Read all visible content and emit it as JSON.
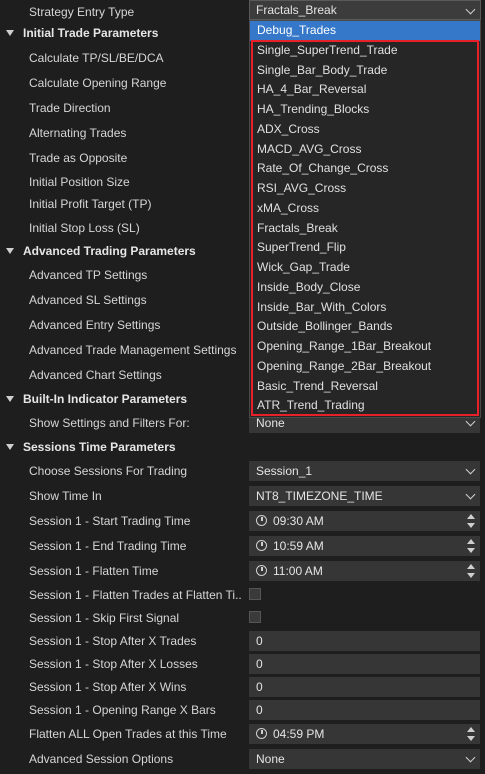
{
  "strategy_entry": {
    "label": "Strategy Entry Type",
    "value": "Fractals_Break"
  },
  "initial_trade": {
    "title": "Initial Trade Parameters",
    "items": [
      "Calculate TP/SL/BE/DCA",
      "Calculate Opening Range",
      "Trade Direction",
      "Alternating Trades",
      "Trade as Opposite",
      "Initial Position Size",
      "Initial Profit Target (TP)",
      "Initial Stop Loss (SL)"
    ]
  },
  "advanced_trading": {
    "title": "Advanced Trading Parameters",
    "items": [
      "Advanced TP Settings",
      "Advanced SL Settings",
      "Advanced Entry Settings",
      "Advanced Trade Management Settings",
      "Advanced Chart Settings"
    ]
  },
  "built_in": {
    "title": "Built-In Indicator Parameters",
    "show_settings_label": "Show Settings and Filters For:",
    "show_settings_value": "None"
  },
  "sessions": {
    "title": "Sessions Time Parameters",
    "choose_label": "Choose Sessions For Trading",
    "choose_value": "Session_1",
    "show_time_label": "Show Time In",
    "show_time_value": "NT8_TIMEZONE_TIME",
    "start_label": "Session 1 - Start Trading Time",
    "start_value": "09:30 AM",
    "end_label": "Session 1 - End Trading Time",
    "end_value": "10:59 AM",
    "flatten_label": "Session 1 - Flatten Time",
    "flatten_value": "11:00 AM",
    "flatten_trades_label": "Session 1 - Flatten Trades at Flatten Ti...",
    "skip_first_label": "Session 1 - Skip First Signal",
    "stop_trades_label": "Session 1 - Stop After X Trades",
    "stop_trades_value": "0",
    "stop_losses_label": "Session 1 - Stop After X Losses",
    "stop_losses_value": "0",
    "stop_wins_label": "Session 1 - Stop After X Wins",
    "stop_wins_value": "0",
    "opening_range_label": "Session 1 - Opening Range X Bars",
    "opening_range_value": "0",
    "flatten_all_label": "Flatten ALL Open Trades at this Time",
    "flatten_all_value": "04:59 PM",
    "advanced_label": "Advanced Session Options",
    "advanced_value": "None"
  },
  "dropdown": {
    "options": [
      "Debug_Trades",
      "Single_SuperTrend_Trade",
      "Single_Bar_Body_Trade",
      "HA_4_Bar_Reversal",
      "HA_Trending_Blocks",
      "ADX_Cross",
      "MACD_AVG_Cross",
      "Rate_Of_Change_Cross",
      "RSI_AVG_Cross",
      "xMA_Cross",
      "Fractals_Break",
      "SuperTrend_Flip",
      "Wick_Gap_Trade",
      "Inside_Body_Close",
      "Inside_Bar_With_Colors",
      "Outside_Bollinger_Bands",
      "Opening_Range_1Bar_Breakout",
      "Opening_Range_2Bar_Breakout",
      "Basic_Trend_Reversal",
      "ATR_Trend_Trading"
    ]
  },
  "colors": {
    "background": "#1e1e1e",
    "selected": "#3578c9",
    "highlight_box": "#e8202a"
  }
}
